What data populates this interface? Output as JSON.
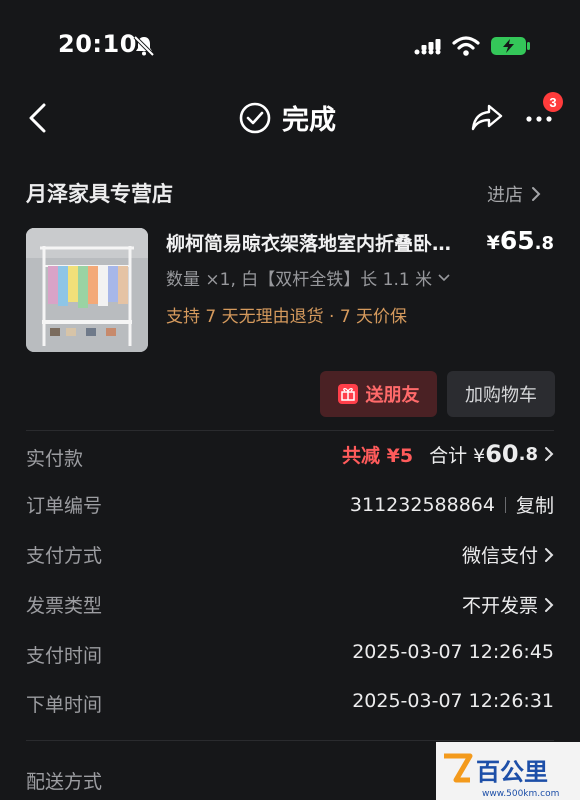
{
  "status_bar": {
    "time": "20:10"
  },
  "nav": {
    "title": "完成",
    "badge_count": "3"
  },
  "store": {
    "name": "月泽家具专营店",
    "enter_label": "进店"
  },
  "product": {
    "title": "柳柯简易晾衣架落地室内折叠卧室挂衣架",
    "price_symbol": "¥",
    "price_integer": "65",
    "price_decimal": ".8",
    "spec": "数量 ×1, 白【双杆全铁】长 1.1 米",
    "service": "支持 7 天无理由退货 · 7 天价保"
  },
  "buttons": {
    "gift": "送朋友",
    "add_cart": "加购物车"
  },
  "order": {
    "paid_label": "实付款",
    "discount": "共减 ¥5",
    "total_prefix": "合计 ¥",
    "total_integer": "60",
    "total_decimal": ".8",
    "number_label": "订单编号",
    "number_value": "311232588864",
    "copy_label": "复制",
    "payment_method_label": "支付方式",
    "payment_method_value": "微信支付",
    "invoice_label": "发票类型",
    "invoice_value": "不开发票",
    "pay_time_label": "支付时间",
    "pay_time_value": "2025-03-07 12:26:45",
    "order_time_label": "下单时间",
    "order_time_value": "2025-03-07 12:26:31",
    "delivery_label": "配送方式"
  },
  "watermark": {
    "text": "百公里",
    "url": "www.500km.com"
  },
  "colors": {
    "background": "#161719",
    "discount_red": "#ff5b5b",
    "service_orange": "#d59a5d",
    "gift_button_bg": "#4a2124",
    "badge_red": "#ff3b3b"
  }
}
